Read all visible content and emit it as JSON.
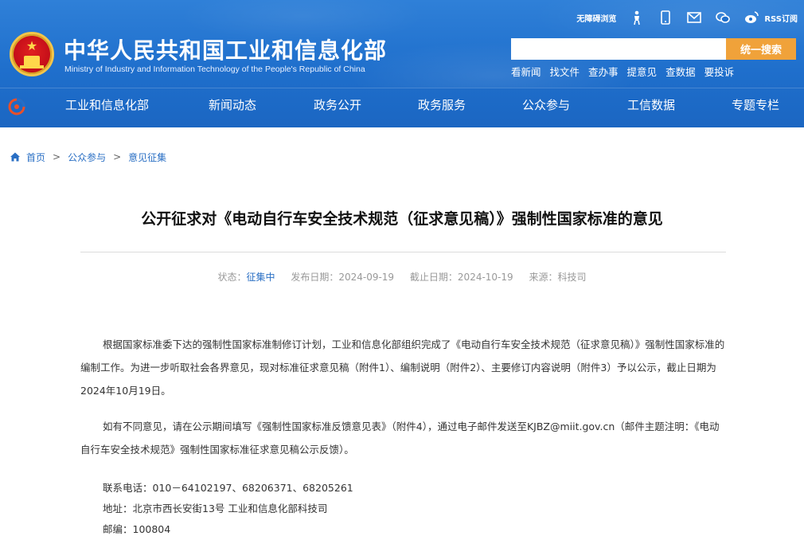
{
  "header": {
    "title": "中华人民共和国工业和信息化部",
    "subtitle": "Ministry of Industry and Information Technology of the People's Republic of China",
    "accessibility_link": "无障碍浏览",
    "rss_label": "RSS订阅",
    "search": {
      "placeholder": "",
      "button_label": "统一搜索"
    },
    "quick_links": [
      "看新闻",
      "找文件",
      "查办事",
      "提意见",
      "查数据",
      "要投诉"
    ],
    "colors": {
      "header_blue": "#1f6fcc",
      "search_button": "#f0a23a"
    }
  },
  "nav": {
    "items": [
      "工业和信息化部",
      "新闻动态",
      "政务公开",
      "政务服务",
      "公众参与",
      "工信数据",
      "专题专栏"
    ]
  },
  "breadcrumb": {
    "items": [
      "首页",
      "公众参与",
      "意见征集"
    ],
    "separator": ">"
  },
  "article": {
    "title": "公开征求对《电动自行车安全技术规范（征求意见稿）》强制性国家标准的意见",
    "meta": {
      "status_label": "状态：",
      "status_value": "征集中",
      "publish_label": "发布日期：",
      "publish_date": "2024-09-19",
      "deadline_label": "截止日期：",
      "deadline_date": "2024-10-19",
      "source_label": "来源：",
      "source_value": "科技司"
    },
    "paragraphs": [
      "根据国家标准委下达的强制性国家标准制修订计划，工业和信息化部组织完成了《电动自行车安全技术规范（征求意见稿）》强制性国家标准的编制工作。为进一步听取社会各界意见，现对标准征求意见稿（附件1）、编制说明（附件2）、主要修订内容说明（附件3）予以公示，截止日期为2024年10月19日。",
      "如有不同意见，请在公示期间填写《强制性国家标准反馈意见表》（附件4），通过电子邮件发送至KJBZ@miit.gov.cn（邮件主题注明：《电动自行车安全技术规范》强制性国家标准征求意见稿公示反馈）。"
    ],
    "contacts": {
      "phone": "联系电话：010－64102197、68206371、68205261",
      "address": "地址：北京市西长安街13号 工业和信息化部科技司",
      "postcode": "邮编：100804"
    }
  }
}
